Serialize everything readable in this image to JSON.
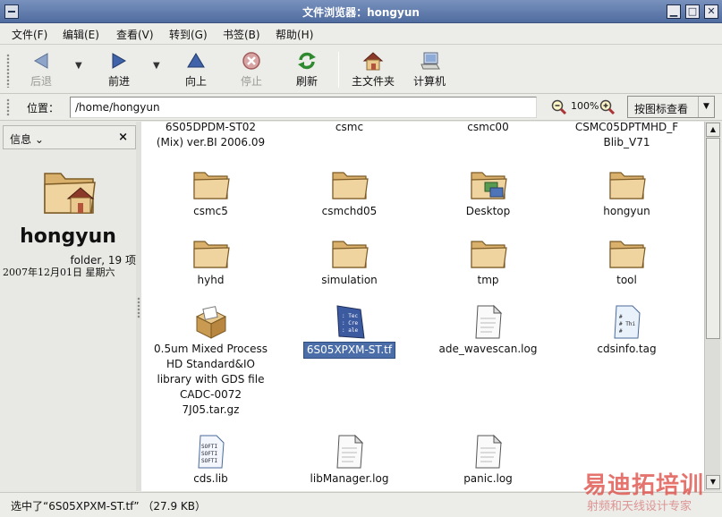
{
  "window": {
    "title": "文件浏览器：hongyun",
    "min_label": "▁",
    "max_label": "□",
    "close_label": "✕"
  },
  "menu": [
    "文件(F)",
    "编辑(E)",
    "查看(V)",
    "转到(G)",
    "书签(B)",
    "帮助(H)"
  ],
  "toolbar": {
    "back": "后退",
    "forward": "前进",
    "up": "向上",
    "stop": "停止",
    "reload": "刷新",
    "home": "主文件夹",
    "computer": "计算机",
    "dropdown": "▼"
  },
  "location": {
    "label": "位置：",
    "path": "/home/hongyun",
    "zoom": "100%",
    "view_mode": "按图标查看",
    "view_arrow": "▼"
  },
  "sidebar": {
    "title": "信息",
    "title_arrow": "⌄",
    "close": "×",
    "name": "hongyun",
    "meta": "folder, 19 项",
    "date": "2007年12月01日  星期六"
  },
  "files": [
    {
      "label": "6S05DPDM-ST02\n(Mix) ver.BI  2006.09",
      "icon": "none"
    },
    {
      "label": "csmc",
      "icon": "none"
    },
    {
      "label": "csmc00",
      "icon": "none"
    },
    {
      "label": "CSMC05DPTMHD_F\nBlib_V71",
      "icon": "none"
    },
    {
      "label": "csmc5",
      "icon": "folder-icon"
    },
    {
      "label": "csmchd05",
      "icon": "folder-icon"
    },
    {
      "label": "Desktop",
      "icon": "desktop-folder-icon"
    },
    {
      "label": "hongyun",
      "icon": "folder-icon"
    },
    {
      "label": "hyhd",
      "icon": "folder-icon"
    },
    {
      "label": "simulation",
      "icon": "folder-icon"
    },
    {
      "label": "tmp",
      "icon": "folder-icon"
    },
    {
      "label": "tool",
      "icon": "folder-icon"
    },
    {
      "label": "0.5um Mixed Process\nHD Standard&IO\nlibrary with GDS file\nCADC-0072\n7J05.tar.gz",
      "icon": "archive-icon"
    },
    {
      "label": "6S05XPXM-ST.tf",
      "icon": "techfile-icon",
      "selected": true
    },
    {
      "label": "ade_wavescan.log",
      "icon": "text-file-icon"
    },
    {
      "label": "cdsinfo.tag",
      "icon": "script-file-icon"
    },
    {
      "label": "cds.lib",
      "icon": "lib-file-icon"
    },
    {
      "label": "libManager.log",
      "icon": "text-file-icon"
    },
    {
      "label": "panic.log",
      "icon": "text-file-icon"
    }
  ],
  "icon_text": {
    "techfile": [
      ": Tec",
      ": Cre",
      ": ale"
    ],
    "script": [
      "# ",
      "# Thi",
      "#"
    ],
    "lib": [
      "SOFTI",
      "SOFTI",
      "SOFTI"
    ]
  },
  "status": "选中了“6S05XPXM-ST.tf” （27.9  KB）",
  "watermark": {
    "main": "易迪拓培训",
    "sub": "射频和天线设计专家"
  },
  "colors": {
    "titlebar": "#5f7bb0",
    "selection": "#4b6ea9",
    "folder": "#e9c98d"
  }
}
